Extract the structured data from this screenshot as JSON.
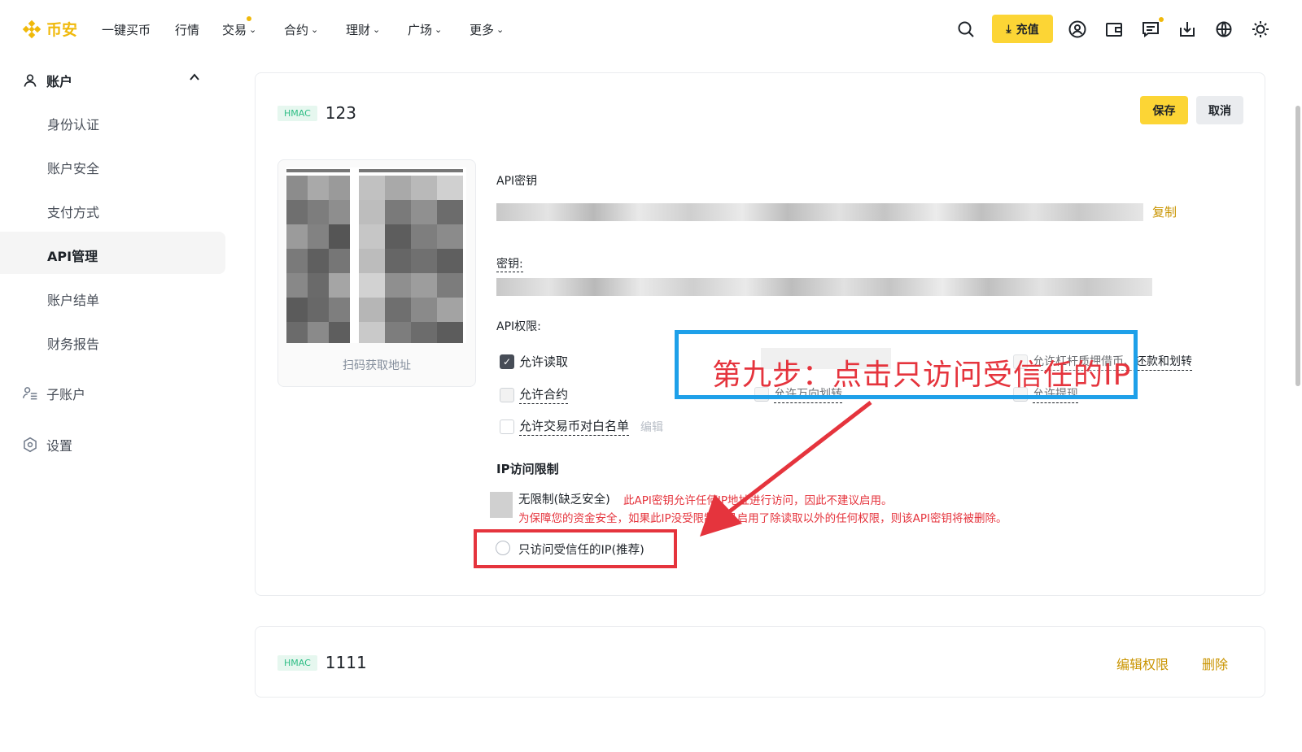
{
  "brand": {
    "name": "币安",
    "color": "#f0b90b"
  },
  "nav": {
    "buy": "一键买币",
    "market": "行情",
    "trade": "交易",
    "futures": "合约",
    "earn": "理财",
    "square": "广场",
    "more": "更多"
  },
  "header_actions": {
    "deposit": "充值"
  },
  "sidebar": {
    "account": "账户",
    "items": [
      "身份认证",
      "账户安全",
      "支付方式",
      "API管理",
      "账户结单",
      "财务报告"
    ],
    "subaccount": "子账户",
    "settings": "设置"
  },
  "api_card": {
    "badge": "HMAC",
    "name": "123",
    "save": "保存",
    "cancel": "取消",
    "qr_caption": "扫码获取地址",
    "api_key_label": "API密钥",
    "copy": "复制",
    "secret_label": "密钥:",
    "perm_label": "API权限:",
    "perm_read": "允许读取",
    "perm_futures": "允许合约",
    "perm_whitelist": "允许交易币对白名单",
    "edit": "编辑",
    "perm_margin": "允许杠杆质押借币、还款和划转",
    "perm_universal": "允许万向划转",
    "perm_withdraw": "允许提现",
    "ip_label": "IP访问限制",
    "ip_unrestricted": "无限制(缺乏安全)",
    "ip_warning1": "此API密钥允许任何IP地址进行访问，因此不建议启用。",
    "ip_warning2": "为保障您的资金安全，如果此IP没受限制，且启用了除读取以外的任何权限，则该API密钥将被删除。",
    "ip_trusted": "只访问受信任的IP(推荐)"
  },
  "annotation": {
    "text": "第九步：点击只访问受信任的IP"
  },
  "api_card2": {
    "badge": "HMAC",
    "name": "1111",
    "edit_perm": "编辑权限",
    "delete": "删除"
  }
}
